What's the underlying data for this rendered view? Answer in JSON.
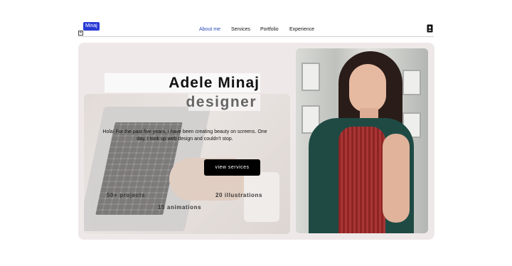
{
  "header": {
    "logo_label": "Minaj",
    "logo_mark": "A",
    "nav": [
      {
        "label": "About me",
        "active": true
      },
      {
        "label": "Services",
        "active": false
      },
      {
        "label": "Portfolio",
        "active": false
      },
      {
        "label": "Experience",
        "active": false
      }
    ],
    "contact_icon": "contact-book-icon"
  },
  "hero": {
    "name": "Adele Minaj",
    "role": "designer",
    "intro": "Hola! For the past five years, I have been creating beauty on screens. One day, I took up web design and couldn't stop.",
    "cta_label": "view services",
    "stats": [
      "50+ projects",
      "20 illustrations",
      "15 animations"
    ]
  },
  "colors": {
    "accent": "#2a3bd6",
    "nav_active": "#2747b6",
    "card_background": "#eee9e8",
    "button": "#000000"
  }
}
